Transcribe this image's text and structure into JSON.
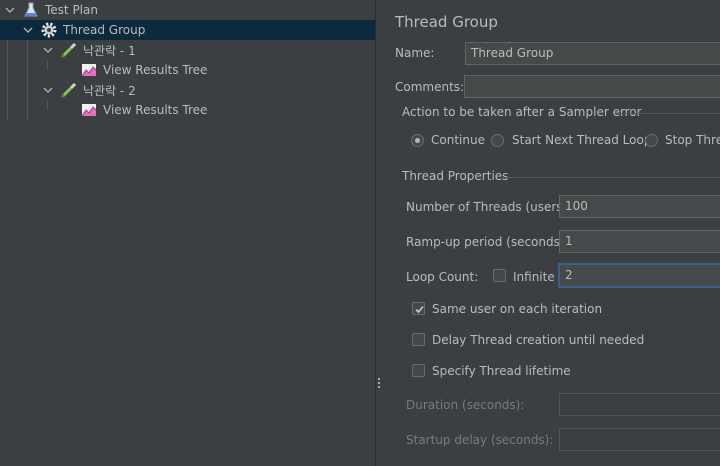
{
  "tree": {
    "items": [
      {
        "label": "Test Plan"
      },
      {
        "label": "Thread Group"
      },
      {
        "label": "낙관락 - 1"
      },
      {
        "label": "View Results Tree"
      },
      {
        "label": "낙관락 - 2"
      },
      {
        "label": "View Results Tree"
      }
    ]
  },
  "panel": {
    "title": "Thread Group",
    "name_label": "Name:",
    "name_value": "Thread Group",
    "comments_label": "Comments:",
    "comments_value": "",
    "sampler_error": {
      "heading": "Action to be taken after a Sampler error",
      "options": [
        "Continue",
        "Start Next Thread Loop",
        "Stop Threa"
      ],
      "selected": "Continue"
    },
    "thread_props": {
      "heading": "Thread Properties",
      "threads_label": "Number of Threads (users):",
      "threads_value": "100",
      "rampup_label": "Ramp-up period (seconds):",
      "rampup_value": "1",
      "loop_label": "Loop Count:",
      "infinite_label": "Infinite",
      "loop_value": "2",
      "same_user_label": "Same user on each iteration",
      "delay_label": "Delay Thread creation until needed",
      "lifetime_label": "Specify Thread lifetime",
      "duration_label": "Duration (seconds):",
      "startup_label": "Startup delay (seconds):"
    }
  },
  "colors": {
    "background": "#3c3f41",
    "selection": "#0d293e",
    "text": "#bbbbbb",
    "disabled_text": "#7a7a7a",
    "focus_border": "#3d6185"
  }
}
